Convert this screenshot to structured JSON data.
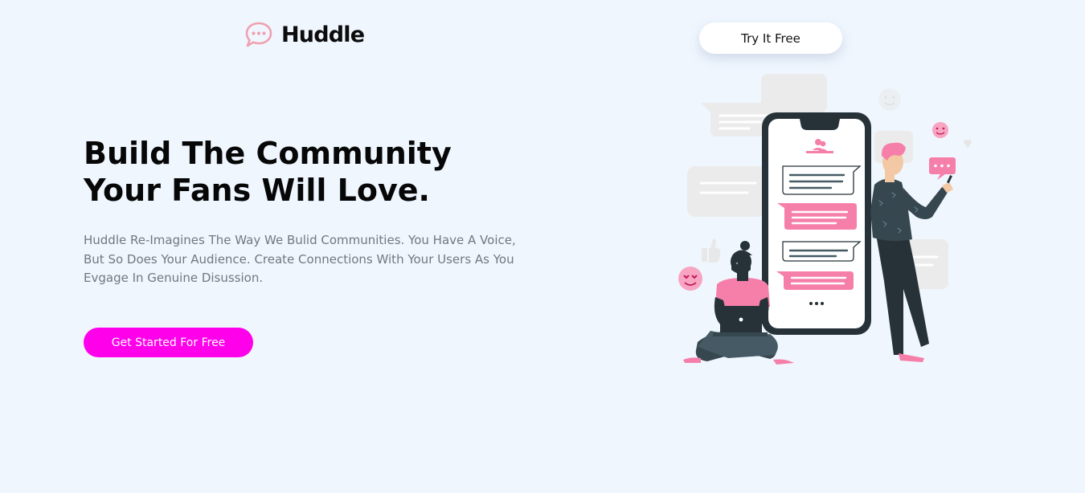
{
  "brand": {
    "name": "Huddle",
    "logo_icon": "chat-bubble-icon",
    "logo_color": "#f0a0b0"
  },
  "header": {
    "cta_label": "Try It Free"
  },
  "hero": {
    "headline_lines": [
      "Build The Community",
      "Your Fans Will Love."
    ],
    "description_lines": [
      "Huddle Re-Imagines The Way We Bulid Communities. You Have A Voice,",
      "But So Does Your Audience. Create Connections With Your Users As You",
      "Evgage In Genuine Disussion."
    ],
    "cta_label": "Get Started For Free"
  },
  "colors": {
    "background": "#eff6fe",
    "primary_cta": "#ff00ea",
    "accent_pink": "#f57fa9",
    "dark": "#263238"
  }
}
